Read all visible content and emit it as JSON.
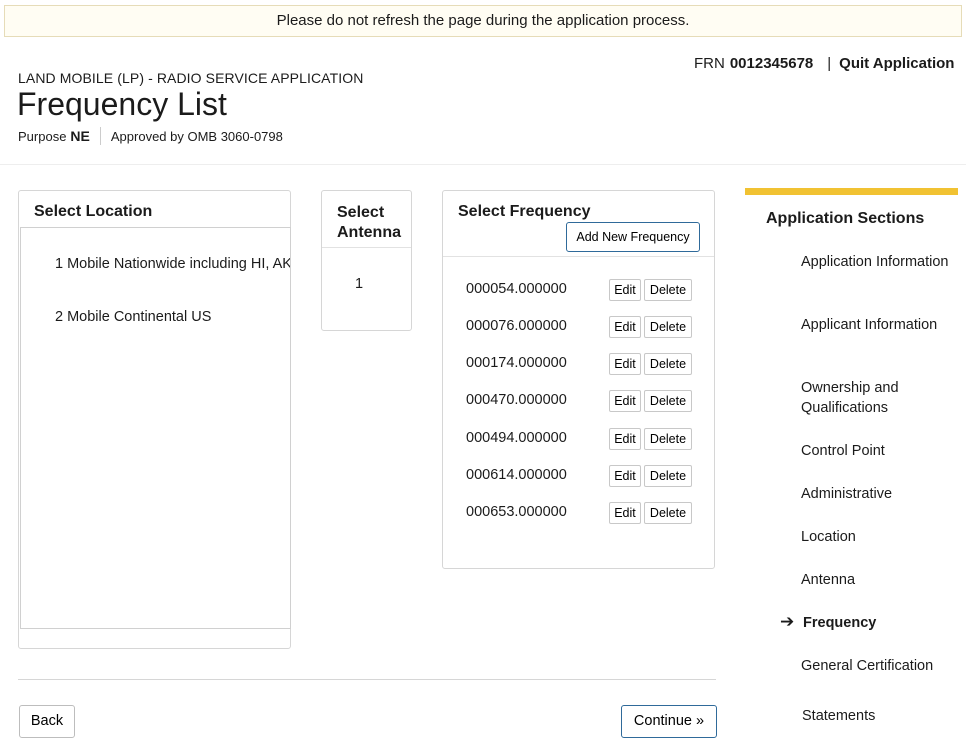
{
  "banner": {
    "text": "Please do not refresh the page during the application process."
  },
  "header": {
    "frn_label": "FRN",
    "frn_value": "0012345678",
    "separator": "|",
    "quit_label": "Quit Application",
    "service": "LAND MOBILE (LP) - RADIO SERVICE APPLICATION",
    "title": "Frequency List",
    "purpose_label": "Purpose",
    "purpose_value": "NE",
    "omb": "Approved by OMB 3060-0798"
  },
  "location": {
    "title": "Select Location",
    "items": [
      "1 Mobile Nationwide including HI, AK",
      "2 Mobile Continental US"
    ]
  },
  "antenna": {
    "title_line1": "Select",
    "title_line2": "Antenna",
    "items": [
      "1"
    ]
  },
  "frequency": {
    "title": "Select Frequency",
    "add_label": "Add New Frequency",
    "edit_label": "Edit",
    "delete_label": "Delete",
    "items": [
      "000054.000000",
      "000076.000000",
      "000174.000000",
      "000470.000000",
      "000494.000000",
      "000614.000000",
      "000653.000000"
    ]
  },
  "footer": {
    "back_label": "Back",
    "continue_label": "Continue »"
  },
  "sidebar": {
    "title": "Application Sections",
    "current_icon": "right-arrow-icon",
    "arrow_glyph": "➔",
    "accent_color": "#f1c232",
    "items": [
      {
        "label": "Application Information"
      },
      {
        "label": "Applicant Information"
      },
      {
        "label": "Ownership and Qualifications"
      },
      {
        "label": "Control Point"
      },
      {
        "label": "Administrative"
      },
      {
        "label": "Location"
      },
      {
        "label": "Antenna"
      },
      {
        "label": "Frequency"
      },
      {
        "label": "General Certification"
      },
      {
        "label": "Statements"
      }
    ]
  }
}
